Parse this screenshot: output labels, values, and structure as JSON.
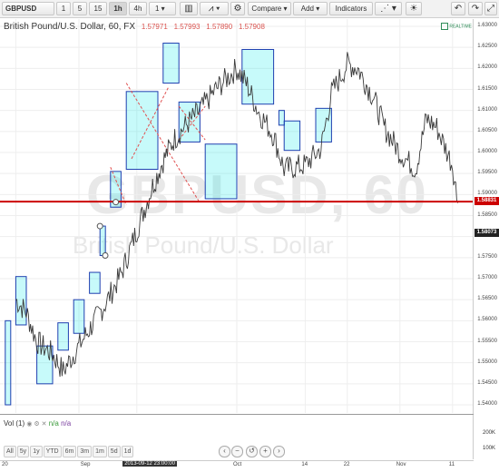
{
  "toolbar": {
    "symbol": "GBPUSD",
    "intervals": [
      "1",
      "5",
      "15",
      "1h",
      "4h",
      "1"
    ],
    "compare_label": "Compare",
    "add_label": "Add",
    "indicators_label": "Indicators"
  },
  "legend": {
    "title": "British Pound/U.S. Dollar, 60, FX",
    "open": "1.57971",
    "high": "1.57993",
    "low": "1.57890",
    "close": "1.57908"
  },
  "realtime_label": "REALTIME",
  "watermark": {
    "symbol": "GBPUSD, 60",
    "name": "British Pound/U.S. Dollar"
  },
  "price_axis": {
    "labels": [
      "1.63000",
      "1.62500",
      "1.62000",
      "1.61500",
      "1.61000",
      "1.60500",
      "1.60000",
      "1.59500",
      "1.59000",
      "1.58500",
      "1.58000",
      "1.57500",
      "1.57000",
      "1.56500",
      "1.56000",
      "1.55500",
      "1.55000",
      "1.54500",
      "1.54000"
    ],
    "current_price": "1.58831",
    "last_price": "1.58073"
  },
  "volume": {
    "label": "Vol (1)",
    "value1": "n/a",
    "value2": "n/a",
    "axis_labels": [
      "200K",
      "100K"
    ]
  },
  "ranges": [
    "All",
    "5y",
    "1y",
    "YTD",
    "6m",
    "3m",
    "1m",
    "5d",
    "1d"
  ],
  "time_axis": {
    "labels": [
      {
        "text": "20"
      },
      {
        "text": "Sep"
      },
      {
        "text": "2013-09-12 23:00:00",
        "highlight": true
      },
      {
        "text": "Oct"
      },
      {
        "text": "14"
      },
      {
        "text": "22"
      },
      {
        "text": "Nov"
      },
      {
        "text": "11"
      }
    ]
  },
  "chart_data": {
    "type": "candlestick",
    "symbol": "GBPUSD",
    "interval": "60",
    "ylim": [
      1.54,
      1.63
    ],
    "horizontal_line": 1.58831,
    "price_points": [
      {
        "t": "Aug 20",
        "p": 1.565
      },
      {
        "t": "Aug 22",
        "p": 1.562
      },
      {
        "t": "Aug 24",
        "p": 1.555
      },
      {
        "t": "Aug 27",
        "p": 1.552
      },
      {
        "t": "Aug 29",
        "p": 1.548
      },
      {
        "t": "Sep 02",
        "p": 1.556
      },
      {
        "t": "Sep 04",
        "p": 1.56
      },
      {
        "t": "Sep 06",
        "p": 1.564
      },
      {
        "t": "Sep 09",
        "p": 1.571
      },
      {
        "t": "Sep 11",
        "p": 1.578
      },
      {
        "t": "Sep 13",
        "p": 1.585
      },
      {
        "t": "Sep 15",
        "p": 1.592
      },
      {
        "t": "Sep 17",
        "p": 1.598
      },
      {
        "t": "Sep 19",
        "p": 1.603
      },
      {
        "t": "Sep 21",
        "p": 1.606
      },
      {
        "t": "Sep 24",
        "p": 1.61
      },
      {
        "t": "Sep 27",
        "p": 1.615
      },
      {
        "t": "Oct 01",
        "p": 1.62
      },
      {
        "t": "Oct 03",
        "p": 1.616
      },
      {
        "t": "Oct 05",
        "p": 1.61
      },
      {
        "t": "Oct 08",
        "p": 1.604
      },
      {
        "t": "Oct 10",
        "p": 1.596
      },
      {
        "t": "Oct 14",
        "p": 1.597
      },
      {
        "t": "Oct 17",
        "p": 1.601
      },
      {
        "t": "Oct 19",
        "p": 1.614
      },
      {
        "t": "Oct 22",
        "p": 1.621
      },
      {
        "t": "Oct 24",
        "p": 1.62
      },
      {
        "t": "Oct 27",
        "p": 1.613
      },
      {
        "t": "Oct 29",
        "p": 1.606
      },
      {
        "t": "Nov 01",
        "p": 1.6
      },
      {
        "t": "Nov 04",
        "p": 1.596
      },
      {
        "t": "Nov 06",
        "p": 1.608
      },
      {
        "t": "Nov 08",
        "p": 1.606
      },
      {
        "t": "Nov 11",
        "p": 1.597
      },
      {
        "t": "Nov 12",
        "p": 1.588
      }
    ],
    "range_boxes": [
      {
        "t1": "Aug 20",
        "t2": "Aug 22",
        "low": 1.559,
        "high": 1.5705
      },
      {
        "t1": "Aug 18",
        "t2": "Aug 19",
        "low": 1.54,
        "high": 1.56
      },
      {
        "t1": "Aug 24",
        "t2": "Aug 27",
        "low": 1.545,
        "high": 1.554
      },
      {
        "t1": "Aug 28",
        "t2": "Aug 30",
        "low": 1.553,
        "high": 1.5595
      },
      {
        "t1": "Aug 31",
        "t2": "Sep 02",
        "low": 1.557,
        "high": 1.565
      },
      {
        "t1": "Sep 03",
        "t2": "Sep 05",
        "low": 1.5665,
        "high": 1.5715
      },
      {
        "t1": "Sep 05",
        "t2": "Sep 06",
        "low": 1.5755,
        "high": 1.5825
      },
      {
        "t1": "Sep 07",
        "t2": "Sep 09",
        "low": 1.587,
        "high": 1.5955
      },
      {
        "t1": "Sep 10",
        "t2": "Sep 16",
        "low": 1.596,
        "high": 1.6145
      },
      {
        "t1": "Sep 17",
        "t2": "Sep 20",
        "low": 1.6165,
        "high": 1.626
      },
      {
        "t1": "Sep 20",
        "t2": "Sep 24",
        "low": 1.6025,
        "high": 1.612
      },
      {
        "t1": "Sep 25",
        "t2": "Oct 01",
        "low": 1.589,
        "high": 1.602
      },
      {
        "t1": "Oct 02",
        "t2": "Oct 08",
        "low": 1.6115,
        "high": 1.6245
      },
      {
        "t1": "Oct 09",
        "t2": "Oct 10",
        "low": 1.6065,
        "high": 1.61
      },
      {
        "t1": "Oct 10",
        "t2": "Oct 13",
        "low": 1.6005,
        "high": 1.6075
      },
      {
        "t1": "Oct 16",
        "t2": "Oct 19",
        "low": 1.6025,
        "high": 1.6105
      }
    ]
  }
}
